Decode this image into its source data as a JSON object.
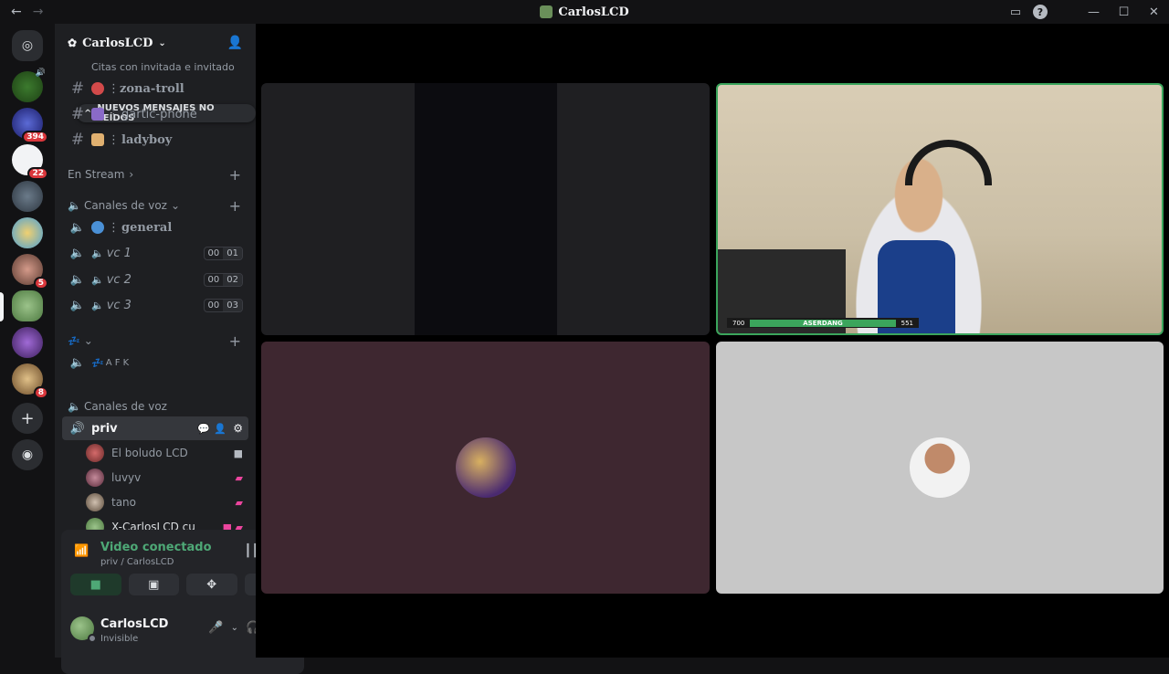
{
  "window": {
    "title": "CarlosLCD"
  },
  "server": {
    "name": "CarlosLCD"
  },
  "guilds": [
    {
      "badge": ""
    },
    {
      "badge": ""
    },
    {
      "badge": "394"
    },
    {
      "badge": "22"
    },
    {
      "badge": ""
    },
    {
      "badge": ""
    },
    {
      "badge": "5"
    },
    {
      "badge": ""
    },
    {
      "badge": ""
    },
    {
      "badge": "8"
    }
  ],
  "channels": {
    "top_cut": "Citas con invitada e invitado",
    "unread_pill": "NUEVOS MENSAJES NO LEÍDOS",
    "text": [
      {
        "name": "zona-troll"
      },
      {
        "name": "gartic-phone"
      },
      {
        "name": "ladyboy"
      }
    ],
    "cat_stream": "En Stream",
    "cat_voice": "Canales de voz",
    "voice": [
      {
        "name": "general",
        "counts": [
          "",
          ""
        ]
      },
      {
        "name": "vc 1",
        "counts": [
          "00",
          "01"
        ]
      },
      {
        "name": "vc 2",
        "counts": [
          "00",
          "02"
        ]
      },
      {
        "name": "vc 3",
        "counts": [
          "00",
          "03"
        ]
      }
    ],
    "afk": "A F K",
    "cat_voice2": "Canales de voz",
    "active_channel": "priv",
    "users": [
      {
        "name": "El boludo LCD"
      },
      {
        "name": "luvyv"
      },
      {
        "name": "tano"
      },
      {
        "name": "X-CarlosLCD cu"
      }
    ]
  },
  "voice_panel": {
    "status": "Video conectado",
    "location": "priv / CarlosLCD"
  },
  "user": {
    "name": "CarlosLCD",
    "status": "Invisible"
  },
  "stream_overlay": {
    "left": "700",
    "center": "ASERDANG",
    "right": "551"
  }
}
